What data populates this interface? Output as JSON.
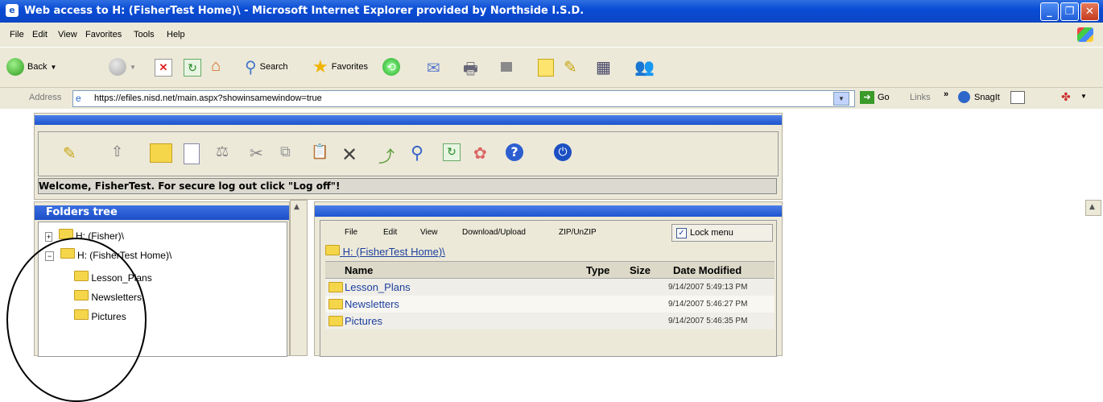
{
  "window": {
    "title": "Web access to H: (FisherTest Home)\\  - Microsoft Internet Explorer provided by Northside I.S.D."
  },
  "menu": [
    "File",
    "Edit",
    "View",
    "Favorites",
    "Tools",
    "Help"
  ],
  "toolbar": {
    "back": "Back",
    "search": "Search",
    "favorites": "Favorites"
  },
  "address": {
    "label": "Address",
    "url": "https://efiles.nisd.net/main.aspx?showinsamewindow=true",
    "go": "Go",
    "links": "Links",
    "snagit": "SnagIt"
  },
  "app": {
    "welcome": "Welcome, FisherTest. For secure log out click \"Log off\"!"
  },
  "tree": {
    "header": "Folders tree",
    "items": [
      {
        "label": "H: (Fisher)\\"
      },
      {
        "label": "H: (FisherTest Home)\\"
      },
      {
        "label": "Lesson_Plans"
      },
      {
        "label": "Newsletters"
      },
      {
        "label": "Pictures"
      }
    ]
  },
  "filepane": {
    "menu": [
      "File",
      "Edit",
      "View",
      "Download/Upload",
      "ZIP/UnZIP"
    ],
    "lock_menu": "Lock menu",
    "path": "H: (FisherTest Home)\\",
    "columns": [
      "Name",
      "Type",
      "Size",
      "Date Modified"
    ],
    "rows": [
      {
        "name": "Lesson_Plans",
        "date": "9/14/2007 5:49:13 PM"
      },
      {
        "name": "Newsletters",
        "date": "9/14/2007 5:46:27 PM"
      },
      {
        "name": "Pictures",
        "date": "9/14/2007 5:46:35 PM"
      }
    ]
  },
  "colors": {
    "xp_blue": "#0a4cd6",
    "folder": "#f5d64a",
    "link": "#1c3f9f"
  }
}
